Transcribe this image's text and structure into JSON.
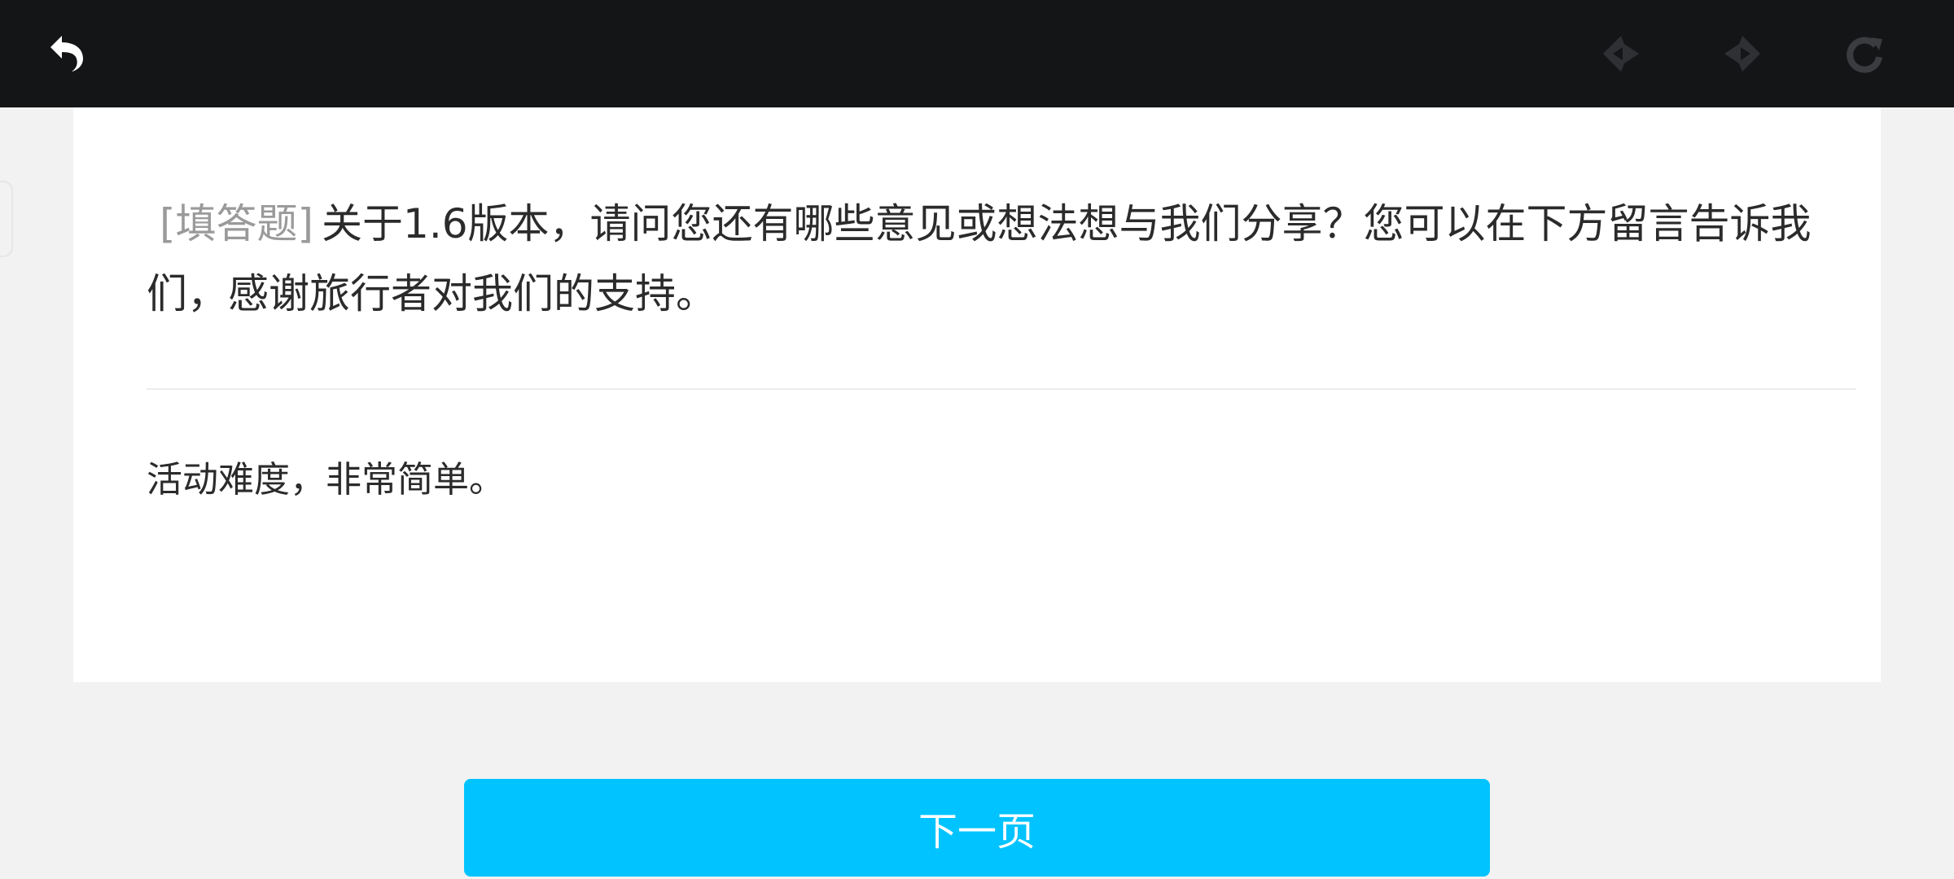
{
  "toolbar": {
    "back_icon": "back-arrow-icon",
    "prev_icon": "left-diamond-arrow-icon",
    "next_icon": "right-diamond-arrow-icon",
    "refresh_icon": "refresh-icon",
    "colors": {
      "bar": "#141517",
      "back_icon": "#ffffff",
      "disabled_icon": "#2e3034",
      "refresh_icon": "#3a3c40"
    }
  },
  "survey": {
    "question_type": "[填答题]",
    "question_text": "关于1.6版本，请问您还有哪些意见或想法想与我们分享？您可以在下方留言告诉我们，感谢旅行者对我们的支持。",
    "answer": "活动难度，非常简单。"
  },
  "footer": {
    "next_label": "下一页",
    "accent": "#00c3ff"
  }
}
